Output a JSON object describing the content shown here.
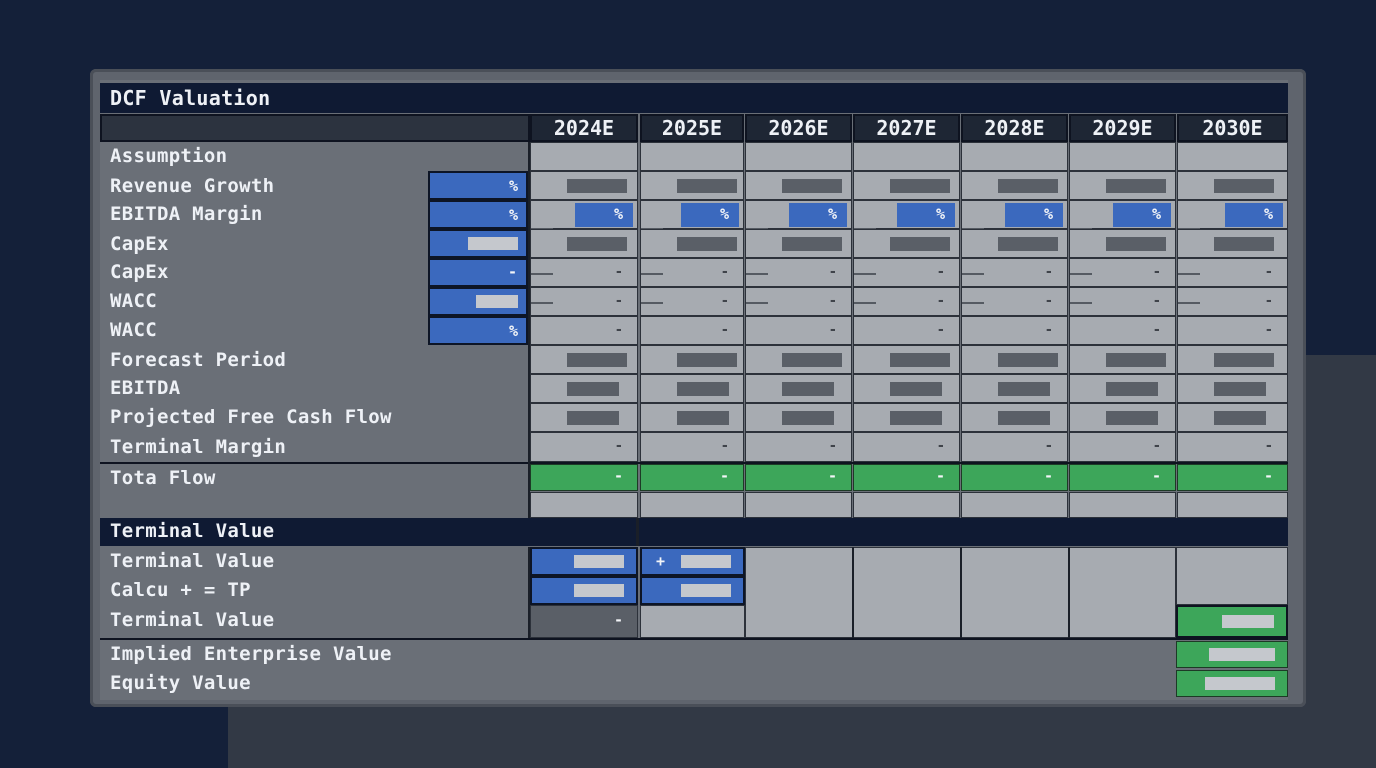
{
  "title": "DCF Valuation",
  "years": [
    "2024E",
    "2025E",
    "2026E",
    "2027E",
    "2028E",
    "2029E",
    "2030E"
  ],
  "rows": {
    "assumption": "Assumption",
    "revenue_growth": "Revenue Growth",
    "ebitda_margin": "EBITDA Margin",
    "capex_1": "CapEx",
    "capex_2": "CapEx",
    "wacc_1": "WACC",
    "wacc_2": "WACC",
    "forecast_period": "Forecast Period",
    "ebitda": "EBITDA",
    "projected_fcf": "Projected Free Cash Flow",
    "terminal_margin": "Terminal Margin",
    "total_flow": "Tota Flow"
  },
  "input_symbols": {
    "percent": "%",
    "dash": "-",
    "plus": "+"
  },
  "terminal_section": {
    "header": "Terminal Value",
    "row1": "Terminal Value",
    "row2": "Calcu + = TP",
    "row3": "Terminal Value"
  },
  "summary": {
    "implied_ev": "Implied Enterprise Value",
    "equity_value": "Equity Value"
  },
  "colors": {
    "background": "#142039",
    "input_blue": "#3b69be",
    "output_green": "#3da65a",
    "cell_gray": "#a7abb1"
  }
}
